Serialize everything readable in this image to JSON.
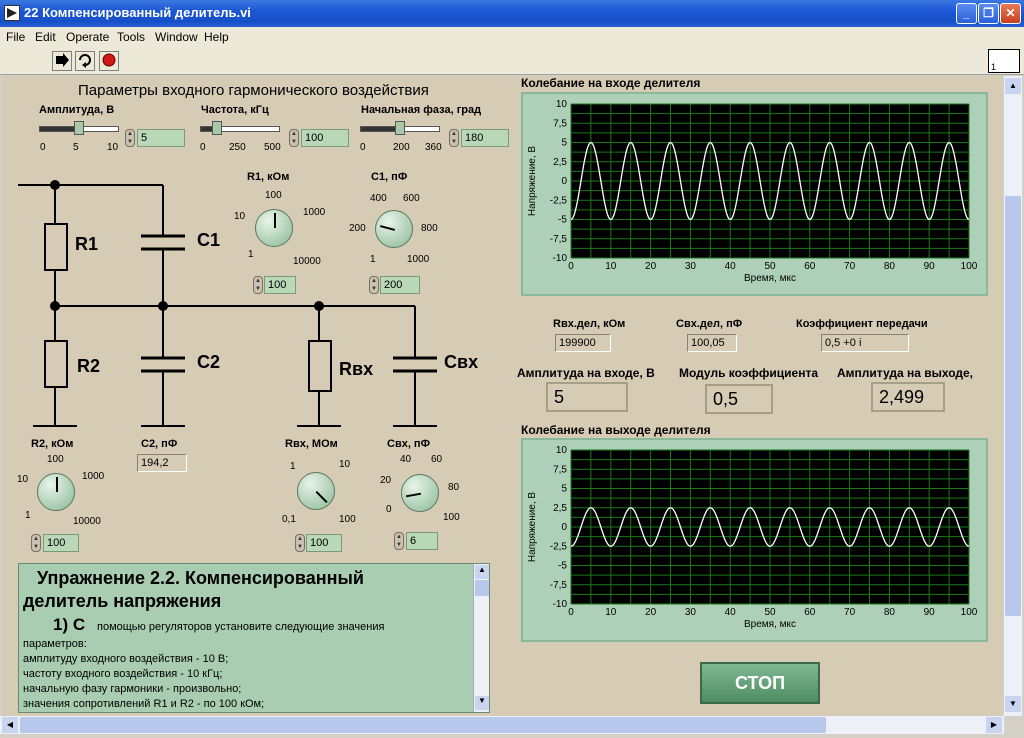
{
  "window": {
    "title": "22 Компенсированный делитель.vi",
    "controls": [
      "_",
      "❐",
      "✕"
    ]
  },
  "menu": [
    "File",
    "Edit",
    "Operate",
    "Tools",
    "Window",
    "Help"
  ],
  "toolbar": {
    "run_icon": "run-arrow-icon",
    "continuous_icon": "run-continuous-icon",
    "abort_icon": "abort-icon"
  },
  "panel_badge": "1",
  "input_params": {
    "title": "Параметры входного гармонического воздействия",
    "amplitude": {
      "label": "Амплитуда, В",
      "ticks": [
        "0",
        "5",
        "10"
      ],
      "value": "5",
      "fraction": 0.5
    },
    "frequency": {
      "label": "Частота, кГц",
      "ticks": [
        "0",
        "250",
        "500"
      ],
      "value": "100",
      "fraction": 0.2
    },
    "phase": {
      "label": "Начальная фаза, град",
      "ticks": [
        "0",
        "200",
        "360"
      ],
      "value": "180",
      "fraction": 0.5
    }
  },
  "circuit": {
    "r1": "R1",
    "c1": "C1",
    "r2": "R2",
    "c2": "C2",
    "rin": "Rвх",
    "cin": "Свх"
  },
  "knobs": {
    "r1": {
      "label": "R1, кОм",
      "scale": [
        "100",
        "1000",
        "10",
        "1",
        "10000"
      ],
      "value": "100"
    },
    "c1": {
      "label": "C1, пФ",
      "scale": [
        "400",
        "600",
        "200",
        "800",
        "1",
        "1000"
      ],
      "value": "200"
    },
    "r2": {
      "label": "R2, кОм",
      "scale": [
        "100",
        "1000",
        "10",
        "1",
        "10000"
      ],
      "value": "100"
    },
    "rin": {
      "label": "Rвх, МОм",
      "scale": [
        "1",
        "10",
        "0,1",
        "100"
      ],
      "value": "100"
    },
    "cin": {
      "label": "Свх, пФ",
      "scale": [
        "40",
        "60",
        "20",
        "80",
        "0",
        "100"
      ],
      "value": "6"
    }
  },
  "c2": {
    "label": "C2, пФ",
    "value": "194,2"
  },
  "results": {
    "rin_div": {
      "label": "Rвх.дел, кОм",
      "value": "199900"
    },
    "cin_div": {
      "label": "Свх.дел, пФ",
      "value": "100,05"
    },
    "transfer": {
      "label": "Коэффициент передачи",
      "value": "0,5 +0 i"
    },
    "amp_in": {
      "label": "Амплитуда на входе, В",
      "value": "5"
    },
    "modulus": {
      "label": "Модуль коэффициента",
      "value": "0,5"
    },
    "amp_out": {
      "label": "Амплитуда на выходе,",
      "value": "2,499"
    }
  },
  "stop_label": "СТОП",
  "instructions": {
    "heading1": "Упражнение 2.2. Компенсированный",
    "heading2": "делитель напряжения",
    "step": "1) С",
    "step_rest": "помощью регуляторов установите следующие значения",
    "lines": [
      "параметров:",
      "амплитуду входного воздействия - 10 В;",
      "частоту входного воздействия - 10 кГц;",
      "начальную фазу гармоники - произвольно;",
      "значения сопротивлений R1 и R2  - по 100 кОм;"
    ]
  },
  "chart_data": [
    {
      "type": "line",
      "title": "Колебание на входе делителя",
      "xlabel": "Время, мкс",
      "ylabel": "Напряжение, В",
      "xlim": [
        0,
        100
      ],
      "ylim": [
        -10,
        10
      ],
      "x_ticks": [
        "0",
        "10",
        "20",
        "30",
        "40",
        "50",
        "60",
        "70",
        "80",
        "90",
        "100"
      ],
      "y_ticks": [
        "10",
        "7,5",
        "5",
        "2,5",
        "0",
        "-2,5",
        "-5",
        "-7,5",
        "-10"
      ],
      "grid": true,
      "series": [
        {
          "amplitude": 5,
          "period": 10,
          "phase_deg": 180,
          "color": "#ffffff"
        }
      ]
    },
    {
      "type": "line",
      "title": "Колебание на выходе делителя",
      "xlabel": "Время, мкс",
      "ylabel": "Напряжение, В",
      "xlim": [
        0,
        100
      ],
      "ylim": [
        -10,
        10
      ],
      "x_ticks": [
        "0",
        "10",
        "20",
        "30",
        "40",
        "50",
        "60",
        "70",
        "80",
        "90",
        "100"
      ],
      "y_ticks": [
        "10",
        "7,5",
        "5",
        "2,5",
        "0",
        "-2,5",
        "-5",
        "-7,5",
        "-10"
      ],
      "grid": true,
      "series": [
        {
          "amplitude": 2.499,
          "period": 10,
          "phase_deg": 180,
          "color": "#ffffff"
        }
      ]
    }
  ]
}
